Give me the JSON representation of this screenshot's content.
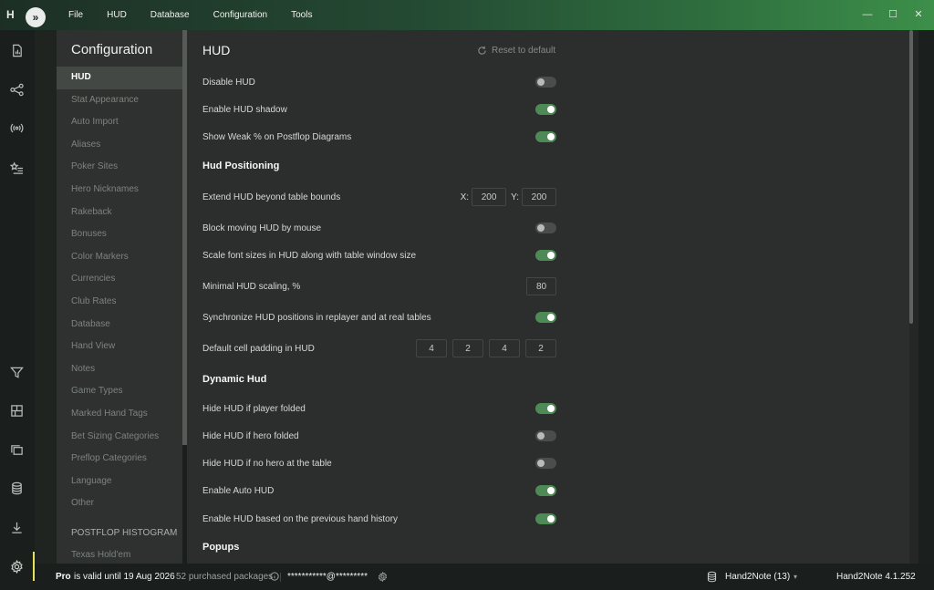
{
  "app": {
    "logo": "H",
    "menu": [
      "File",
      "HUD",
      "Database",
      "Configuration",
      "Tools"
    ],
    "window_controls": [
      "—",
      "☐",
      "✕"
    ]
  },
  "sidebar_icons": [
    "report-icon",
    "share-nodes-icon",
    "broadcast-icon",
    "star-list-icon",
    "filter-icon",
    "layout-icon",
    "windows-icon",
    "database-icon",
    "download-icon",
    "gear-icon"
  ],
  "config_nav": {
    "title": "Configuration",
    "items": [
      "HUD",
      "Stat Appearance",
      "Auto Import",
      "Aliases",
      "Poker Sites",
      "Hero Nicknames",
      "Rakeback",
      "Bonuses",
      "Color Markers",
      "Currencies",
      "Club Rates",
      "Database",
      "Hand View",
      "Notes",
      "Game Types",
      "Marked Hand Tags",
      "Bet Sizing Categories",
      "Preflop Categories",
      "Language",
      "Other"
    ],
    "active": "HUD",
    "section": "POSTFLOP HISTOGRAM",
    "section_items": [
      "Texas Hold'em"
    ]
  },
  "main": {
    "title": "HUD",
    "reset_label": "Reset to default",
    "general": {
      "disable_hud": "Disable HUD",
      "enable_shadow": "Enable HUD shadow",
      "show_weak": "Show Weak % on Postflop Diagrams"
    },
    "positioning": {
      "heading": "Hud Positioning",
      "extend": "Extend HUD beyond table bounds",
      "x_label": "X:",
      "x_value": "200",
      "y_label": "Y:",
      "y_value": "200",
      "block_moving": "Block moving HUD by mouse",
      "scale_font": "Scale font sizes in HUD along with table window size",
      "minimal_scaling": "Minimal HUD scaling, %",
      "minimal_scaling_value": "80",
      "sync_positions": "Synchronize HUD positions in replayer and at real tables",
      "cell_padding": "Default cell padding in HUD",
      "padding_values": [
        "4",
        "2",
        "4",
        "2"
      ]
    },
    "dynamic": {
      "heading": "Dynamic Hud",
      "hide_player_folded": "Hide HUD if player folded",
      "hide_hero_folded": "Hide HUD if hero folded",
      "hide_no_hero": "Hide HUD if no hero at the table",
      "auto_hud": "Enable Auto HUD",
      "prev_hand": "Enable HUD based on the previous hand history"
    },
    "popups": {
      "heading": "Popups"
    },
    "toggles": {
      "disable_hud": false,
      "enable_shadow": true,
      "show_weak": true,
      "block_moving": false,
      "scale_font": true,
      "sync_positions": true,
      "hide_player_folded": true,
      "hide_hero_folded": false,
      "hide_no_hero": false,
      "auto_hud": true,
      "prev_hand": true
    }
  },
  "status": {
    "plan": "Pro",
    "validity": "is valid until 19 Aug 2026",
    "packages": "52 purchased packages",
    "email": "***********@*********",
    "database": "Hand2Note (13)",
    "version": "Hand2Note 4.1.252"
  },
  "colors": {
    "accent_green": "#4d8a55",
    "active_marker": "#e7e05a"
  }
}
